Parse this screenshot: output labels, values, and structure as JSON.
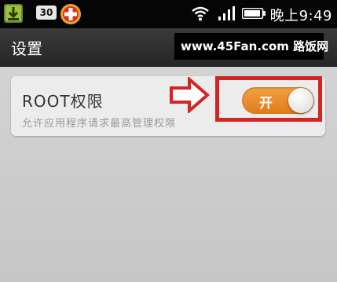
{
  "status_bar": {
    "notification_badge": "30",
    "clock": "晚上9:49",
    "icons": [
      "download-icon",
      "badge-icon",
      "plus-icon",
      "wifi-icon",
      "signal-icon",
      "battery-icon"
    ]
  },
  "title_bar": {
    "title": "设置"
  },
  "watermark": {
    "text": "www.45Fan.com 路饭网"
  },
  "setting": {
    "title": "ROOT权限",
    "description": "允许应用程序请求最高管理权限",
    "toggle_label": "开",
    "toggle_on": true
  },
  "colors": {
    "toggle_on": "#e98a2a",
    "highlight": "#d42525",
    "status_bar_bg": "#050505",
    "title_bar_bg": "#2f2f2f",
    "page_bg": "#c9c9c9"
  }
}
